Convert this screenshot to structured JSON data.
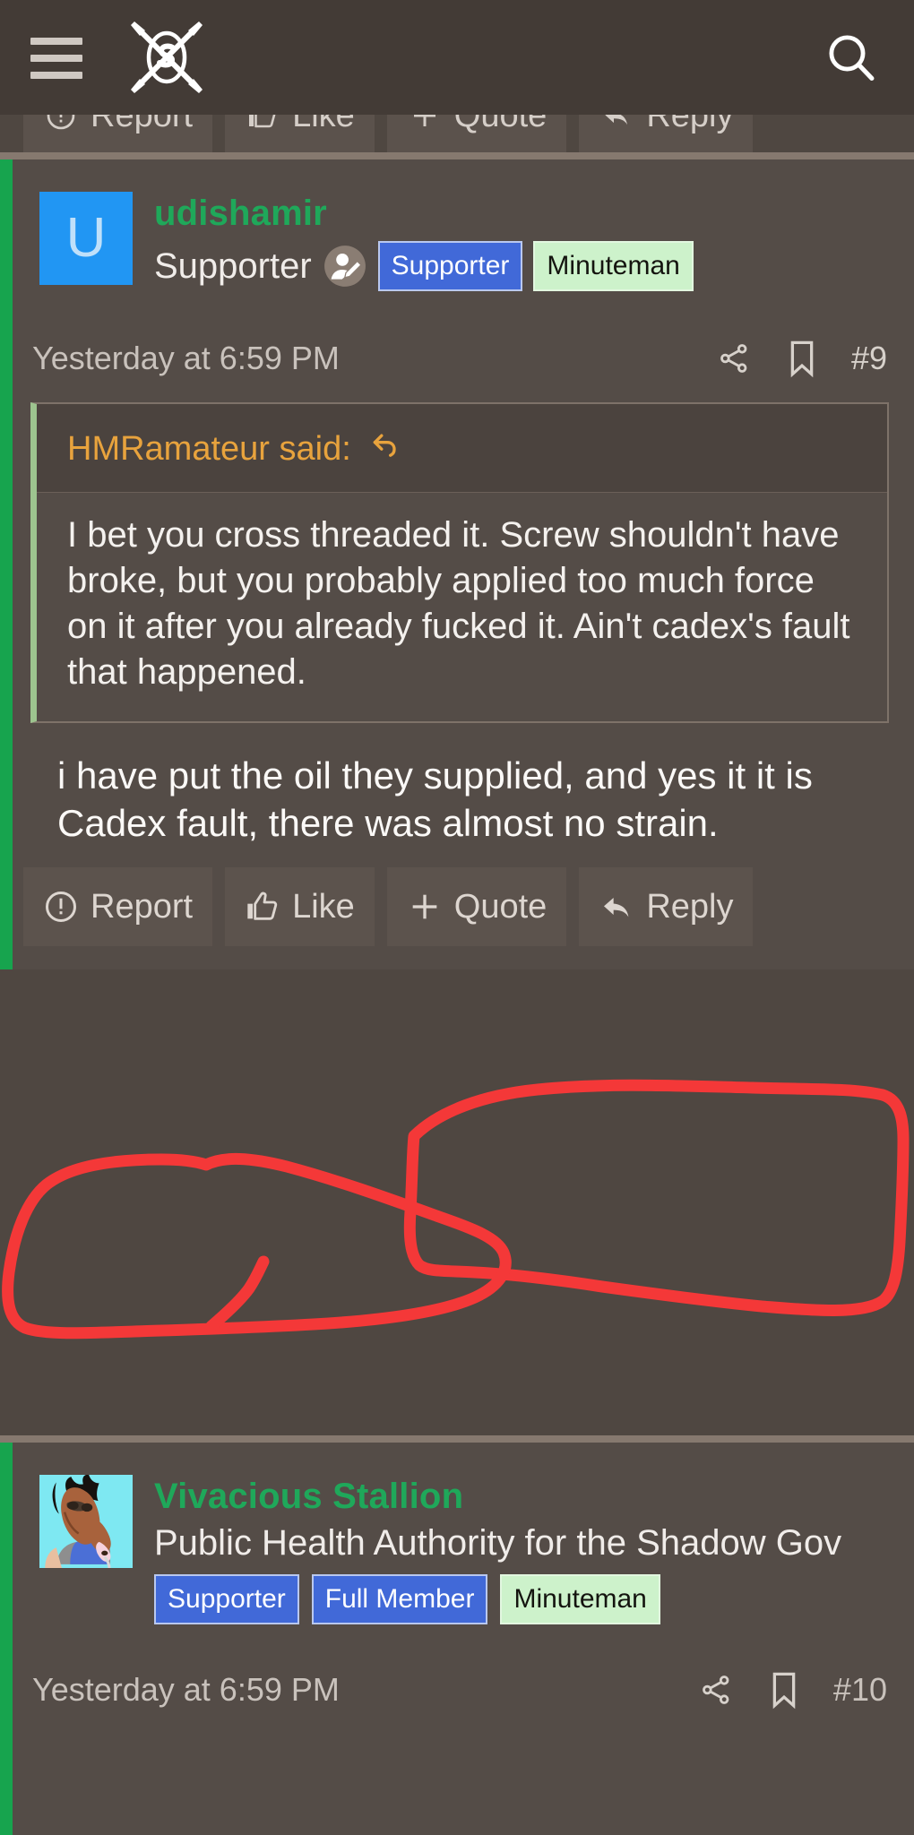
{
  "header": {
    "menu_icon": "hamburger-menu-icon",
    "logo_icon": "crossed-arrows-logo",
    "search_icon": "search-icon"
  },
  "colors": {
    "page_bg": "#4f4741",
    "header_bg": "#433b36",
    "post_bg": "#544c47",
    "divider": "#86796f",
    "accent_green": "#17a44e",
    "username_green": "#1fa85a",
    "quote_orange": "#e8a33d",
    "badge_blue": "#4169d8",
    "badge_green": "#cdf2cb",
    "annotation_red": "#f43838",
    "avatar_blue": "#2196f3"
  },
  "ghost_actions": [
    {
      "label": "Report",
      "icon": "exclamation-circle-icon"
    },
    {
      "label": "Like",
      "icon": "thumbs-up-icon"
    },
    {
      "label": "Quote",
      "icon": "plus-icon"
    },
    {
      "label": "Reply",
      "icon": "reply-arrow-icon"
    }
  ],
  "post": {
    "avatar_letter": "U",
    "username": "udishamir",
    "user_title": "Supporter",
    "user_edit_icon": "user-edit-icon",
    "badges": [
      {
        "label": "Supporter",
        "style": "blue"
      },
      {
        "label": "Minuteman",
        "style": "green"
      }
    ],
    "timestamp": "Yesterday at 6:59 PM",
    "share_icon": "share-icon",
    "bookmark_icon": "bookmark-icon",
    "post_number": "#9",
    "quote": {
      "attribution": "HMRamateur said:",
      "jump_icon": "reply-arrow-icon",
      "text": "I bet you cross threaded it. Screw shouldn't have broke, but you probably applied too much force on it after you already fucked it. Ain't cadex's fault that happened."
    },
    "text": "i have put the oil they supplied, and yes it it is Cadex fault, there was almost no strain.",
    "actions": [
      {
        "label": "Report",
        "icon": "exclamation-circle-icon"
      },
      {
        "label": "Like",
        "icon": "thumbs-up-icon"
      },
      {
        "label": "Quote",
        "icon": "plus-icon"
      },
      {
        "label": "Reply",
        "icon": "reply-arrow-icon"
      }
    ]
  },
  "post2": {
    "avatar_image": "bojack-horseman-avatar",
    "username": "Vivacious Stallion",
    "user_title": "Public Health Authority for the Shadow Gov",
    "badges": [
      {
        "label": "Supporter",
        "style": "blue"
      },
      {
        "label": "Full Member",
        "style": "blue"
      },
      {
        "label": "Minuteman",
        "style": "green"
      }
    ],
    "timestamp": "Yesterday at 6:59 PM",
    "share_icon": "share-icon",
    "bookmark_icon": "bookmark-icon",
    "post_number": "#10"
  },
  "annotation": {
    "type": "freehand-red-circle",
    "color": "#f43838",
    "stroke_width": 13,
    "description": "Hand-drawn red loops circling the phrase about Cadex fault and no strain"
  }
}
